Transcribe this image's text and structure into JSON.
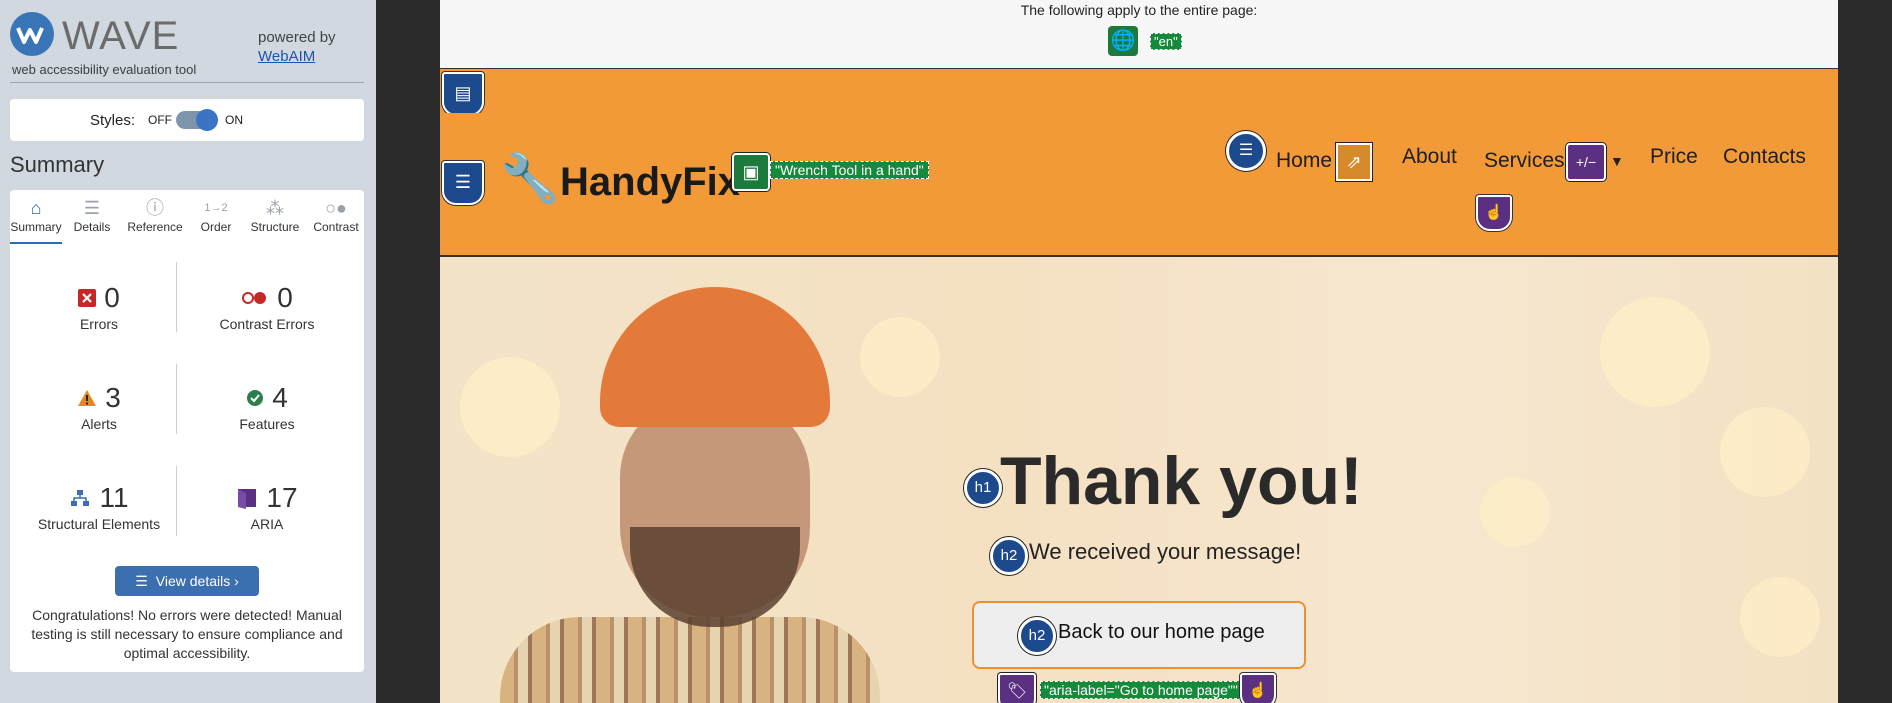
{
  "wave": {
    "logo_text": "WAVE",
    "tagline": "web accessibility evaluation tool",
    "powered_by": "powered by",
    "powered_link": "WebAIM",
    "styles_label": "Styles:",
    "styles_off": "OFF",
    "styles_on": "ON",
    "summary_title": "Summary",
    "tabs": [
      {
        "label": "Summary",
        "icon": "home-icon"
      },
      {
        "label": "Details",
        "icon": "list-icon"
      },
      {
        "label": "Reference",
        "icon": "info-icon"
      },
      {
        "label": "Order",
        "icon": "order-icon"
      },
      {
        "label": "Structure",
        "icon": "structure-icon"
      },
      {
        "label": "Contrast",
        "icon": "contrast-icon"
      }
    ],
    "stats": {
      "errors": {
        "value": "0",
        "label": "Errors"
      },
      "contrast_errors": {
        "value": "0",
        "label": "Contrast Errors"
      },
      "alerts": {
        "value": "3",
        "label": "Alerts"
      },
      "features": {
        "value": "4",
        "label": "Features"
      },
      "structural": {
        "value": "11",
        "label": "Structural Elements"
      },
      "aria": {
        "value": "17",
        "label": "ARIA"
      }
    },
    "view_details": "View details ›",
    "congrats": "Congratulations! No errors were detected! Manual testing is still necessary to ensure compliance and optimal accessibility.",
    "colors": {
      "primary": "#3b6fb0",
      "error": "#c62828",
      "alert": "#e08a1e",
      "feature": "#2e7d4f",
      "aria": "#5b2f82"
    }
  },
  "page": {
    "apply_text": "The following apply to the entire page:",
    "lang_tag": "\"en\"",
    "brand": "HandyFix",
    "logo_alt": "\"Wrench Tool in a hand\"",
    "nav": [
      "Home",
      "About",
      "Services",
      "Price",
      "Contacts"
    ],
    "aria_expand_badge": "+/−",
    "h1_badge": "h1",
    "h2_badge": "h2",
    "heading": "Thank you!",
    "subheading": "We received your message!",
    "home_button": "Back to our home page",
    "aria_label_tag": "\"aria-label=\"Go to home page\"\"",
    "colors": {
      "header": "#f39a38",
      "tag_green": "#158a3a",
      "wave_blue": "#1d4a8d",
      "wave_purple": "#5b2f82"
    }
  }
}
